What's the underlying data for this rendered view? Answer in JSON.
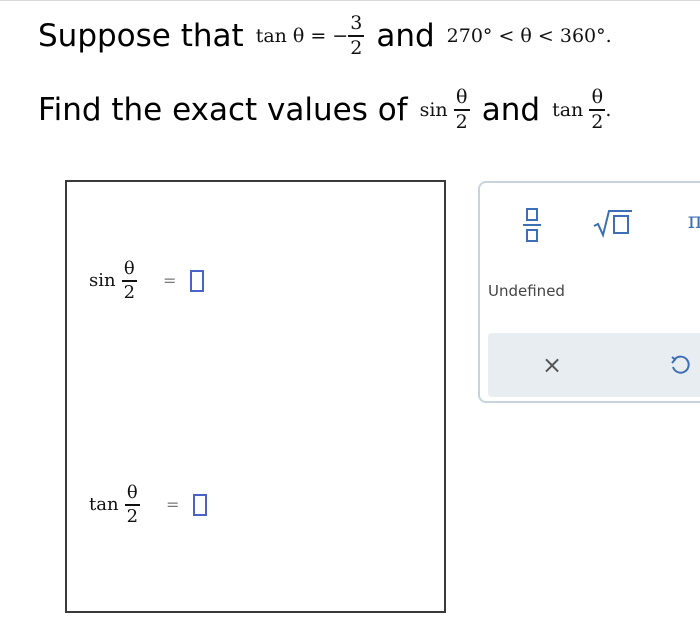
{
  "question": {
    "line1": {
      "lead": "Suppose that",
      "tan_fn": "tan",
      "theta": "θ",
      "equals_neg": "= −",
      "frac_num": "3",
      "frac_den": "2",
      "and": "and",
      "range": "270° < θ < 360°."
    },
    "line2": {
      "lead": "Find the exact values of",
      "sin_fn": "sin",
      "frac_num": "θ",
      "frac_den": "2",
      "and": "and",
      "tan_fn": "tan",
      "tail": "."
    }
  },
  "answers": [
    {
      "fn": "sin",
      "num": "θ",
      "den": "2",
      "equals": "="
    },
    {
      "fn": "tan",
      "num": "θ",
      "den": "2",
      "equals": "="
    }
  ],
  "palette": {
    "pi_symbol": "π",
    "undefined_label": "Undefined",
    "clear_symbol": "×"
  },
  "colors": {
    "accent": "#3d6fb6",
    "slot_border": "#4a63c6",
    "action_bar_bg": "#e8edf2"
  },
  "icons": [
    "fraction-icon",
    "square-root-icon",
    "pi-icon",
    "clear-icon",
    "undo-icon"
  ]
}
